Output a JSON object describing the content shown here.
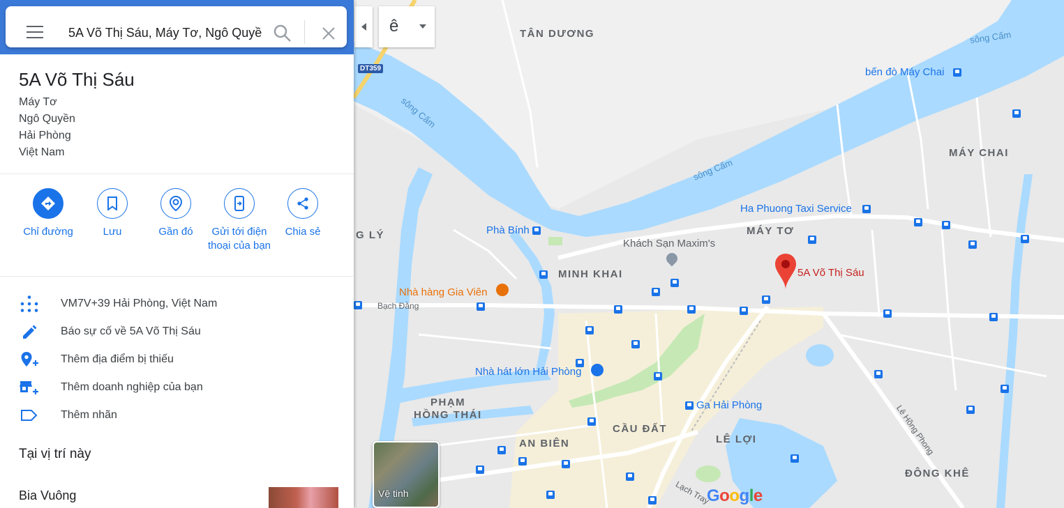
{
  "search": {
    "value": "5A Võ Thị Sáu, Máy Tơ, Ngô Quyề"
  },
  "place": {
    "title": "5A Võ Thị Sáu",
    "address_lines": [
      "Máy Tơ",
      "Ngô Quyền",
      "Hải Phòng",
      "Việt Nam"
    ]
  },
  "actions": [
    {
      "label": "Chỉ đường",
      "icon": "directions-icon"
    },
    {
      "label": "Lưu",
      "icon": "bookmark-icon"
    },
    {
      "label": "Gần đó",
      "icon": "nearby-icon"
    },
    {
      "label": "Gửi tới điện thoại của bạn",
      "icon": "send-to-phone-icon"
    },
    {
      "label": "Chia sẻ",
      "icon": "share-icon"
    }
  ],
  "info_rows": [
    {
      "text": "VM7V+39 Hải Phòng, Việt Nam",
      "icon": "plus-code-icon"
    },
    {
      "text": "Báo sự cố về 5A Võ Thị Sáu",
      "icon": "edit-icon"
    },
    {
      "text": "Thêm địa điểm bị thiếu",
      "icon": "add-place-icon"
    },
    {
      "text": "Thêm doanh nghiệp của bạn",
      "icon": "add-business-icon"
    },
    {
      "text": "Thêm nhãn",
      "icon": "label-icon"
    }
  ],
  "nearby": {
    "section_title": "Tại vị trí này",
    "first_item": "Bia Vuông"
  },
  "map": {
    "input_tool_char": "ê",
    "satellite_label": "Vệ tinh",
    "logo": "Google",
    "pin_label": "5A Võ Thị Sáu",
    "road_shield": "DT359",
    "districts": [
      "TÂN DƯƠNG",
      "MÁY CHAI",
      "MÁY TƠ",
      "MINH KHAI",
      "PHẠM",
      "HỒNG THÁI",
      "AN BIÊN",
      "CẦU ĐẤT",
      "LÊ LỢI",
      "ĐÔNG KHÊ",
      "G LÝ"
    ],
    "rivers": [
      "sông Cấm",
      "sông Cấm",
      "sông Cấm"
    ],
    "pois": {
      "ben_do": "bến đò Máy Chai",
      "ha_phuong": "Ha Phuong Taxi Service",
      "pha_binh": "Phà Bính",
      "maxim": "Khách Sạn Maxim's",
      "gia_vien": "Nhà hàng Gia Viên",
      "nha_hat": "Nhà hát lớn Hải Phòng",
      "ga": "Ga Hải Phòng"
    },
    "roads": [
      "Bạch Đằng",
      "Lê Hồng Phong",
      "Lạch Tray"
    ]
  },
  "colors": {
    "accent": "#1a73e8",
    "panel_header": "#3b79d8",
    "water": "#aadaff",
    "pin": "#ea4335"
  }
}
